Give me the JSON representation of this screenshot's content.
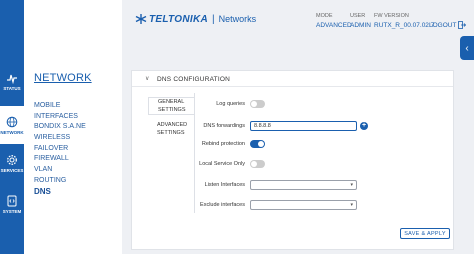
{
  "sidebar": {
    "items": [
      {
        "label": "STATUS",
        "icon": "status-pulse-icon"
      },
      {
        "label": "NETWORK",
        "icon": "globe-icon"
      },
      {
        "label": "SERVICES",
        "icon": "gear-icon"
      },
      {
        "label": "SYSTEM",
        "icon": "system-code-icon"
      }
    ]
  },
  "nav": {
    "title": "NETWORK",
    "items": [
      "MOBILE",
      "INTERFACES",
      "BONDIX S.A.NE",
      "WIRELESS",
      "FAILOVER",
      "FIREWALL",
      "VLAN",
      "ROUTING",
      "DNS"
    ]
  },
  "header": {
    "brand": "TELTONIKA",
    "separator": "|",
    "product": "Networks",
    "mode_label": "MODE",
    "mode_value": "ADVANCED",
    "user_label": "USER",
    "user_value": "ADMIN",
    "fw_label": "FW VERSION",
    "fw_value": "RUTX_R_00.07.02.7",
    "logout": "LOGOUT"
  },
  "section": {
    "title": "DNS CONFIGURATION",
    "tabs": [
      "GENERAL SETTINGS",
      "ADVANCED SETTINGS"
    ],
    "fields": [
      {
        "label": "Log queries",
        "type": "toggle",
        "state": "off"
      },
      {
        "label": "DNS forwardings",
        "type": "input",
        "value": "8.8.8.8"
      },
      {
        "label": "Rebind protection",
        "type": "toggle",
        "state": "on"
      },
      {
        "label": "Local Service Only",
        "type": "toggle",
        "state": "off"
      },
      {
        "label": "Listen Interfaces",
        "type": "select",
        "value": ""
      },
      {
        "label": "Exclude interfaces",
        "type": "select",
        "value": ""
      }
    ],
    "save": "SAVE & APPLY"
  },
  "colors": {
    "brand": "#1a5fae",
    "background": "#eef0f4"
  }
}
